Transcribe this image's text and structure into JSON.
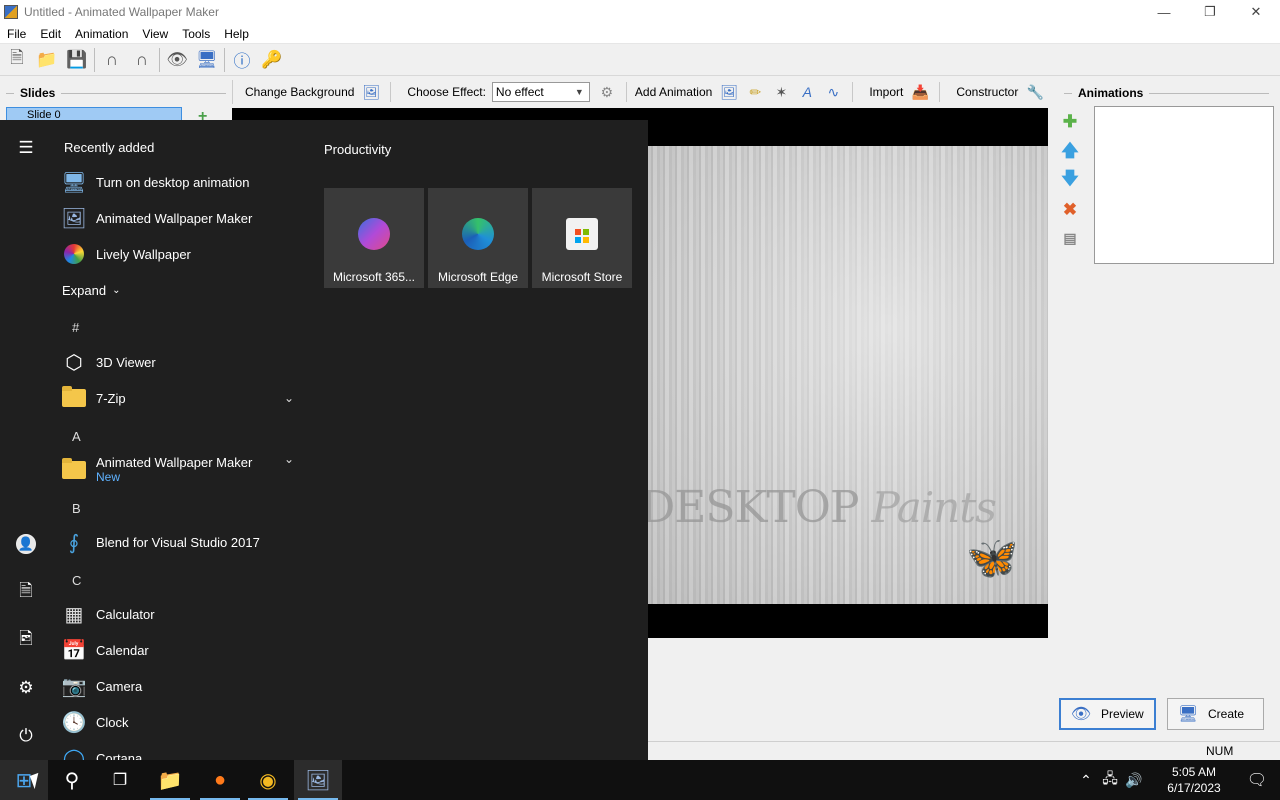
{
  "window": {
    "title": "Untitled - Animated Wallpaper Maker",
    "minimize_icon": "minimize-icon",
    "maximize_icon": "restore-icon",
    "close_icon": "close-icon"
  },
  "menu": [
    "File",
    "Edit",
    "Animation",
    "View",
    "Tools",
    "Help"
  ],
  "toolbar": {
    "buttons": [
      "new-file-icon",
      "open-folder-icon",
      "save-icon",
      "undo-magnet-icon",
      "redo-magnet-icon",
      "preview-eye-icon",
      "set-wallpaper-icon",
      "info-icon",
      "key-icon"
    ]
  },
  "slides": {
    "header": "Slides",
    "items": [
      "Slide 0"
    ]
  },
  "effect_bar": {
    "change_background": "Change Background",
    "choose_effect_label": "Choose Effect:",
    "effect_value": "No effect",
    "add_animation": "Add Animation",
    "import": "Import",
    "constructor": "Constructor"
  },
  "animations": {
    "header": "Animations"
  },
  "canvas": {
    "logo_text": "DESKTOP",
    "logo_script": "Paints"
  },
  "buttons": {
    "preview": "Preview",
    "create": "Create"
  },
  "status": {
    "num": "NUM"
  },
  "start_menu": {
    "recently_added_title": "Recently added",
    "recent": [
      {
        "name": "Turn on desktop animation",
        "icon": "desktop-animation-icon"
      },
      {
        "name": "Animated Wallpaper Maker",
        "icon": "wallpaper-maker-icon"
      },
      {
        "name": "Lively Wallpaper",
        "icon": "lively-wallpaper-icon"
      }
    ],
    "expand_label": "Expand",
    "letters": [
      "#",
      "A",
      "B",
      "C"
    ],
    "apps": [
      {
        "name": "3D Viewer",
        "icon": "cube-icon"
      },
      {
        "name": "7-Zip",
        "icon": "folder-icon"
      },
      {
        "name": "Animated Wallpaper Maker",
        "icon": "folder-icon",
        "sub": "New"
      },
      {
        "name": "Blend for Visual Studio 2017",
        "icon": "blend-icon"
      },
      {
        "name": "Calculator",
        "icon": "calculator-icon"
      },
      {
        "name": "Calendar",
        "icon": "calendar-icon"
      },
      {
        "name": "Camera",
        "icon": "camera-icon"
      },
      {
        "name": "Clock",
        "icon": "clock-icon"
      },
      {
        "name": "Cortana",
        "icon": "cortana-icon"
      }
    ],
    "productivity_title": "Productivity",
    "tiles": [
      {
        "name": "Microsoft 365...",
        "icon": "microsoft-365-icon",
        "color": "#6b4fc8"
      },
      {
        "name": "Microsoft Edge",
        "icon": "edge-icon",
        "color": "#1f8fd8"
      },
      {
        "name": "Microsoft Store",
        "icon": "store-icon",
        "color": "#f2f2f2"
      }
    ]
  },
  "taskbar": {
    "apps": [
      "start-icon",
      "search-icon",
      "task-view-icon",
      "file-explorer-icon",
      "firefox-icon",
      "chrome-icon",
      "wallpaper-maker-icon"
    ],
    "time": "5:05 AM",
    "date": "6/17/2023"
  }
}
